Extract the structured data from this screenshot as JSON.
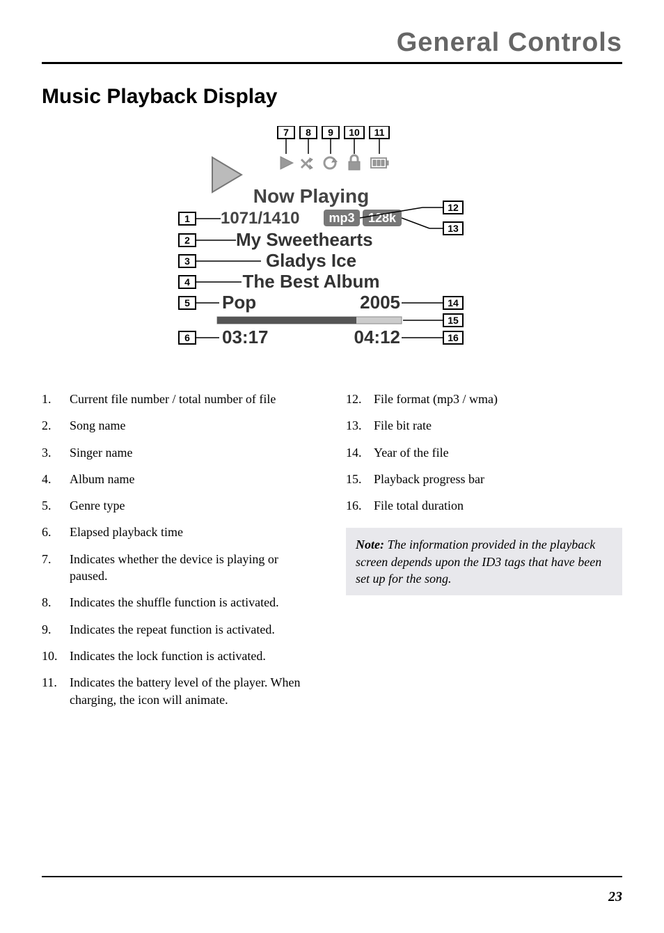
{
  "header": "General Controls",
  "section_title": "Music Playback Display",
  "screen": {
    "now_playing": "Now Playing",
    "file_count": "1071/1410",
    "format_badge": "mp3",
    "bitrate_badge": "128k",
    "song": "My Sweethearts",
    "artist": "Gladys Ice",
    "album": "The Best Album",
    "genre": "Pop",
    "year": "2005",
    "elapsed": "03:17",
    "total": "04:12"
  },
  "callouts": {
    "c1": "1",
    "c2": "2",
    "c3": "3",
    "c4": "4",
    "c5": "5",
    "c6": "6",
    "c7": "7",
    "c8": "8",
    "c9": "9",
    "c10": "10",
    "c11": "11",
    "c12": "12",
    "c13": "13",
    "c14": "14",
    "c15": "15",
    "c16": "16"
  },
  "legend_left": [
    "Current file number / total number of file",
    "Song name",
    "Singer name",
    "Album name",
    "Genre type",
    "Elapsed playback time",
    "Indicates whether the device is playing or paused.",
    "Indicates the shuffle function is activated.",
    "Indicates the repeat function is activated.",
    "Indicates the lock function is activated.",
    "Indicates the battery level of the player. When charging, the icon will animate."
  ],
  "legend_right": [
    "File format (mp3 / wma)",
    "File bit rate",
    "Year of the file",
    "Playback progress bar",
    "File total duration"
  ],
  "note_label": "Note:",
  "note_text": " The information provided in the playback screen depends upon the ID3 tags that have been set up for the song.",
  "page_number": "23"
}
